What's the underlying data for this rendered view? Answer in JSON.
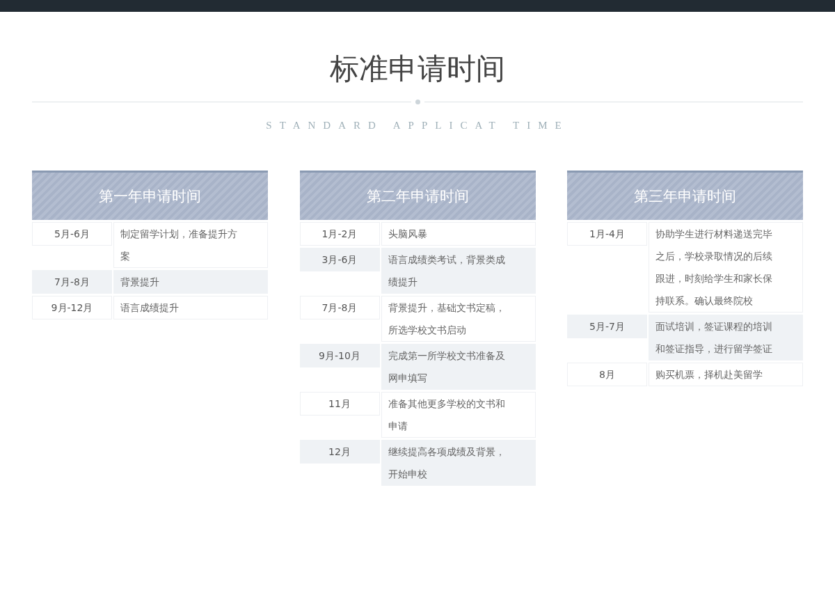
{
  "title": "标准申请时间",
  "subtitle": "STANDARD APPLICAT TIME",
  "columns": [
    {
      "heading": "第一年申请时间",
      "rows": [
        {
          "period": "5月-6月",
          "task": "制定留学计划，准备提升方案"
        },
        {
          "period": "7月-8月",
          "task": "背景提升"
        },
        {
          "period": "9月-12月",
          "task": "语言成绩提升"
        }
      ]
    },
    {
      "heading": "第二年申请时间",
      "rows": [
        {
          "period": "1月-2月",
          "task": "头脑风暴"
        },
        {
          "period": "3月-6月",
          "task": "语言成绩类考试，背景类成绩提升"
        },
        {
          "period": "7月-8月",
          "task": "背景提升，基础文书定稿，所选学校文书启动"
        },
        {
          "period": "9月-10月",
          "task": "完成第一所学校文书准备及网申填写"
        },
        {
          "period": "11月",
          "task": "准备其他更多学校的文书和申请"
        },
        {
          "period": "12月",
          "task": "继续提高各项成绩及背景，开始申校"
        }
      ]
    },
    {
      "heading": "第三年申请时间",
      "rows": [
        {
          "period": "1月-4月",
          "task": "协助学生进行材料递送完毕之后，学校录取情况的后续跟进，时刻给学生和家长保持联系。确认最终院校"
        },
        {
          "period": "5月-7月",
          "task": "面试培训，签证课程的培训和签证指导，进行留学签证"
        },
        {
          "period": "8月",
          "task": "购买机票，择机赴美留学"
        }
      ]
    }
  ]
}
